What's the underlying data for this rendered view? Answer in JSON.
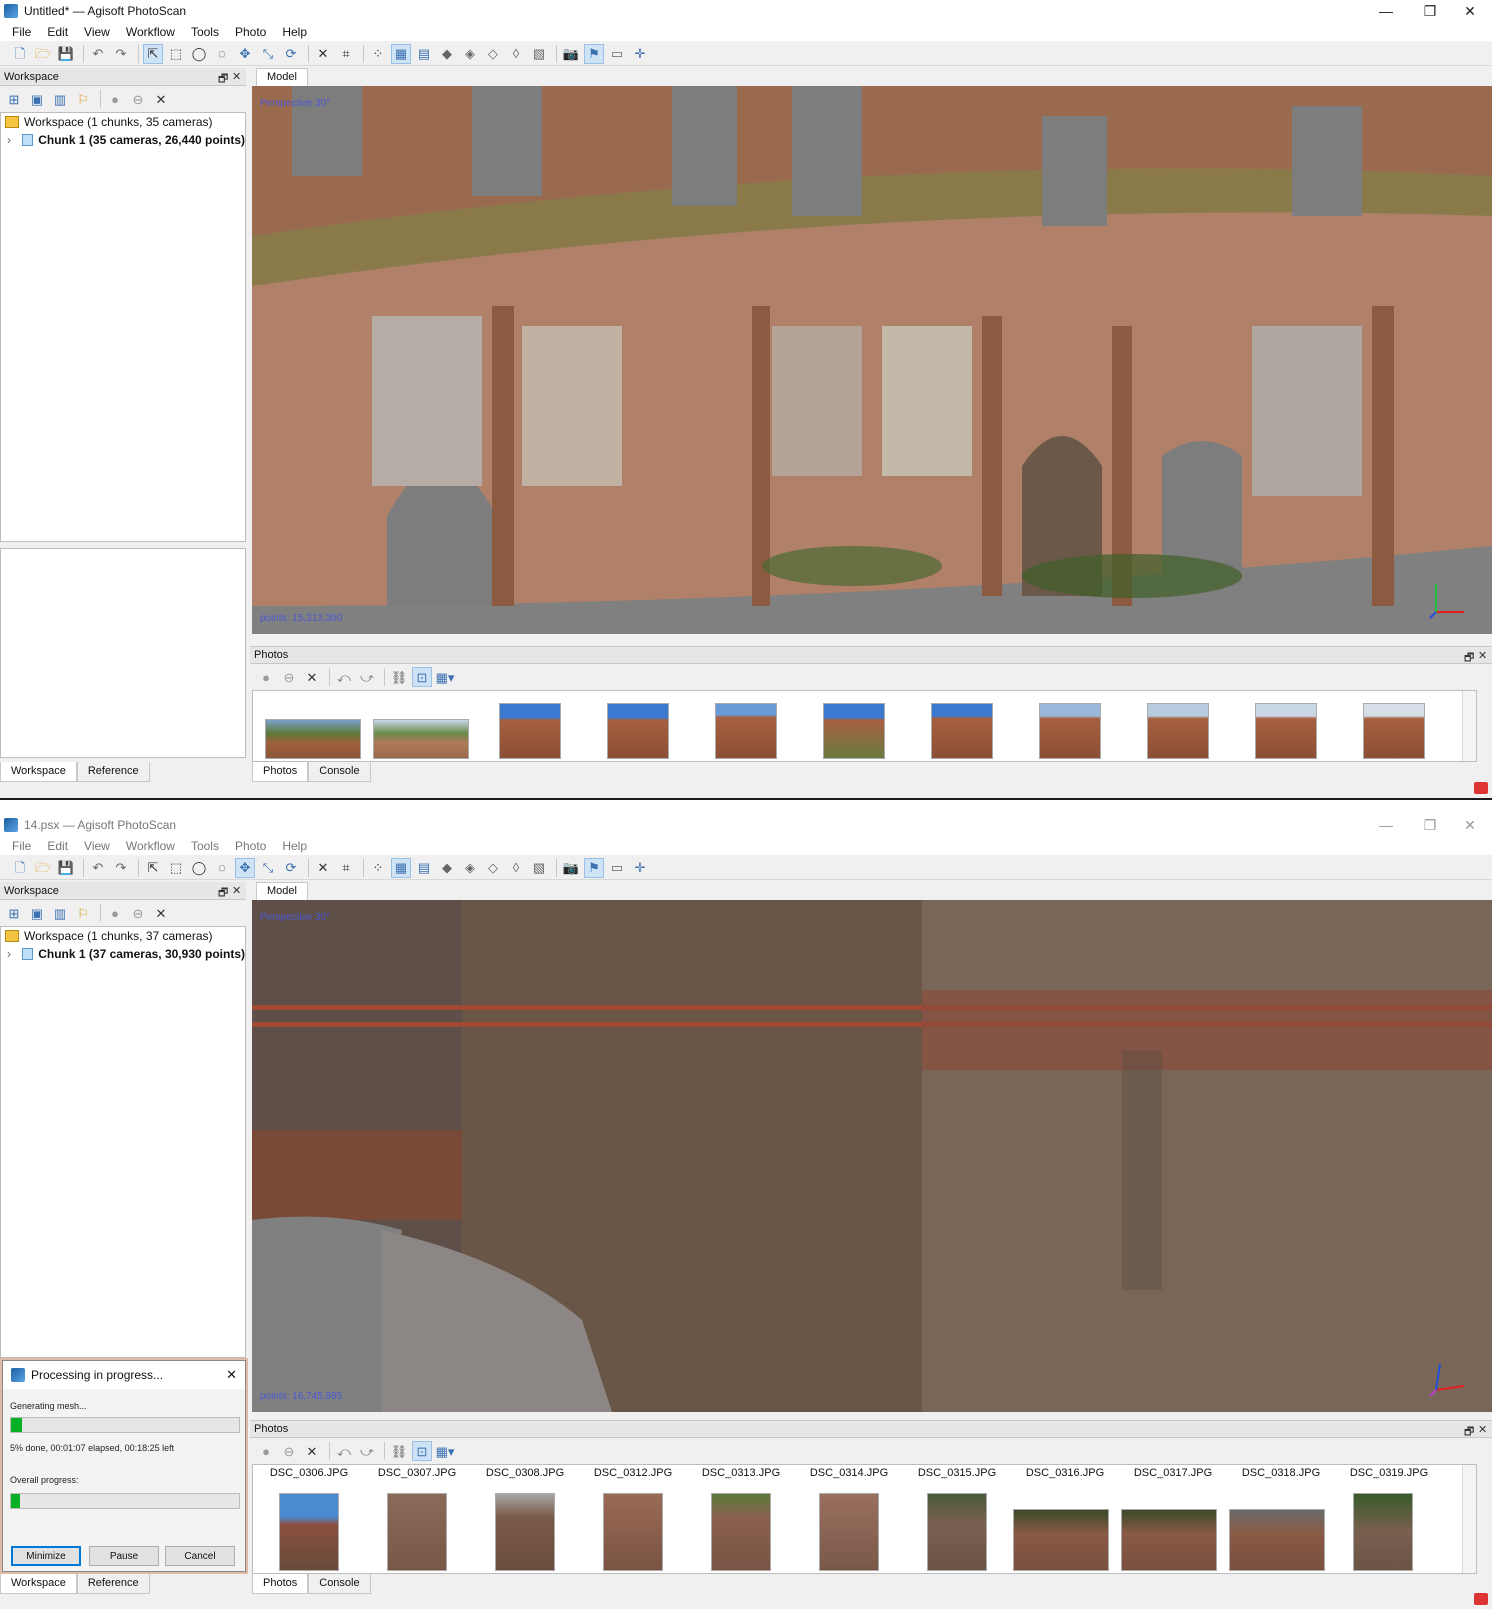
{
  "window1": {
    "title": "Untitled* — Agisoft PhotoScan",
    "menu": [
      "File",
      "Edit",
      "View",
      "Workflow",
      "Tools",
      "Photo",
      "Help"
    ],
    "workspace_header": "Workspace",
    "tree_workspace": "Workspace (1 chunks, 35 cameras)",
    "tree_chunk": "Chunk 1 (35 cameras, 26,440 points)",
    "model_tab": "Model",
    "viewport_label": "Perspective 30°",
    "points_label": "points: 15,313,300",
    "photos_header": "Photos",
    "bottom_left_tabs": [
      "Workspace",
      "Reference"
    ],
    "bottom_photos_tabs": [
      "Photos",
      "Console"
    ],
    "thumbnails": [
      "",
      "",
      "",
      "",
      "",
      "",
      "",
      "",
      "",
      "",
      ""
    ]
  },
  "window2": {
    "title": "14.psx — Agisoft PhotoScan",
    "menu": [
      "File",
      "Edit",
      "View",
      "Workflow",
      "Tools",
      "Photo",
      "Help"
    ],
    "workspace_header": "Workspace",
    "tree_workspace": "Workspace (1 chunks, 37 cameras)",
    "tree_chunk": "Chunk 1 (37 cameras, 30,930 points)",
    "model_tab": "Model",
    "viewport_label": "Perspective 30°",
    "points_label": "points: 16,745,885",
    "photos_header": "Photos",
    "bottom_left_tabs": [
      "Workspace",
      "Reference"
    ],
    "bottom_photos_tabs": [
      "Photos",
      "Console"
    ],
    "thumbnails": [
      "DSC_0306.JPG",
      "DSC_0307.JPG",
      "DSC_0308.JPG",
      "DSC_0312.JPG",
      "DSC_0313.JPG",
      "DSC_0314.JPG",
      "DSC_0315.JPG",
      "DSC_0316.JPG",
      "DSC_0317.JPG",
      "DSC_0318.JPG",
      "DSC_0319.JPG"
    ]
  },
  "dialog": {
    "title": "Processing in progress...",
    "task": "Generating mesh...",
    "task_progress": 0.05,
    "status": "5% done, 00:01:07 elapsed, 00:18:25 left",
    "overall_label": "Overall progress:",
    "overall_progress": 0.04,
    "buttons": {
      "minimize": "Minimize",
      "pause": "Pause",
      "cancel": "Cancel"
    }
  },
  "window_controls": {
    "minimize": "—",
    "maximize": "❐",
    "close": "✕"
  }
}
